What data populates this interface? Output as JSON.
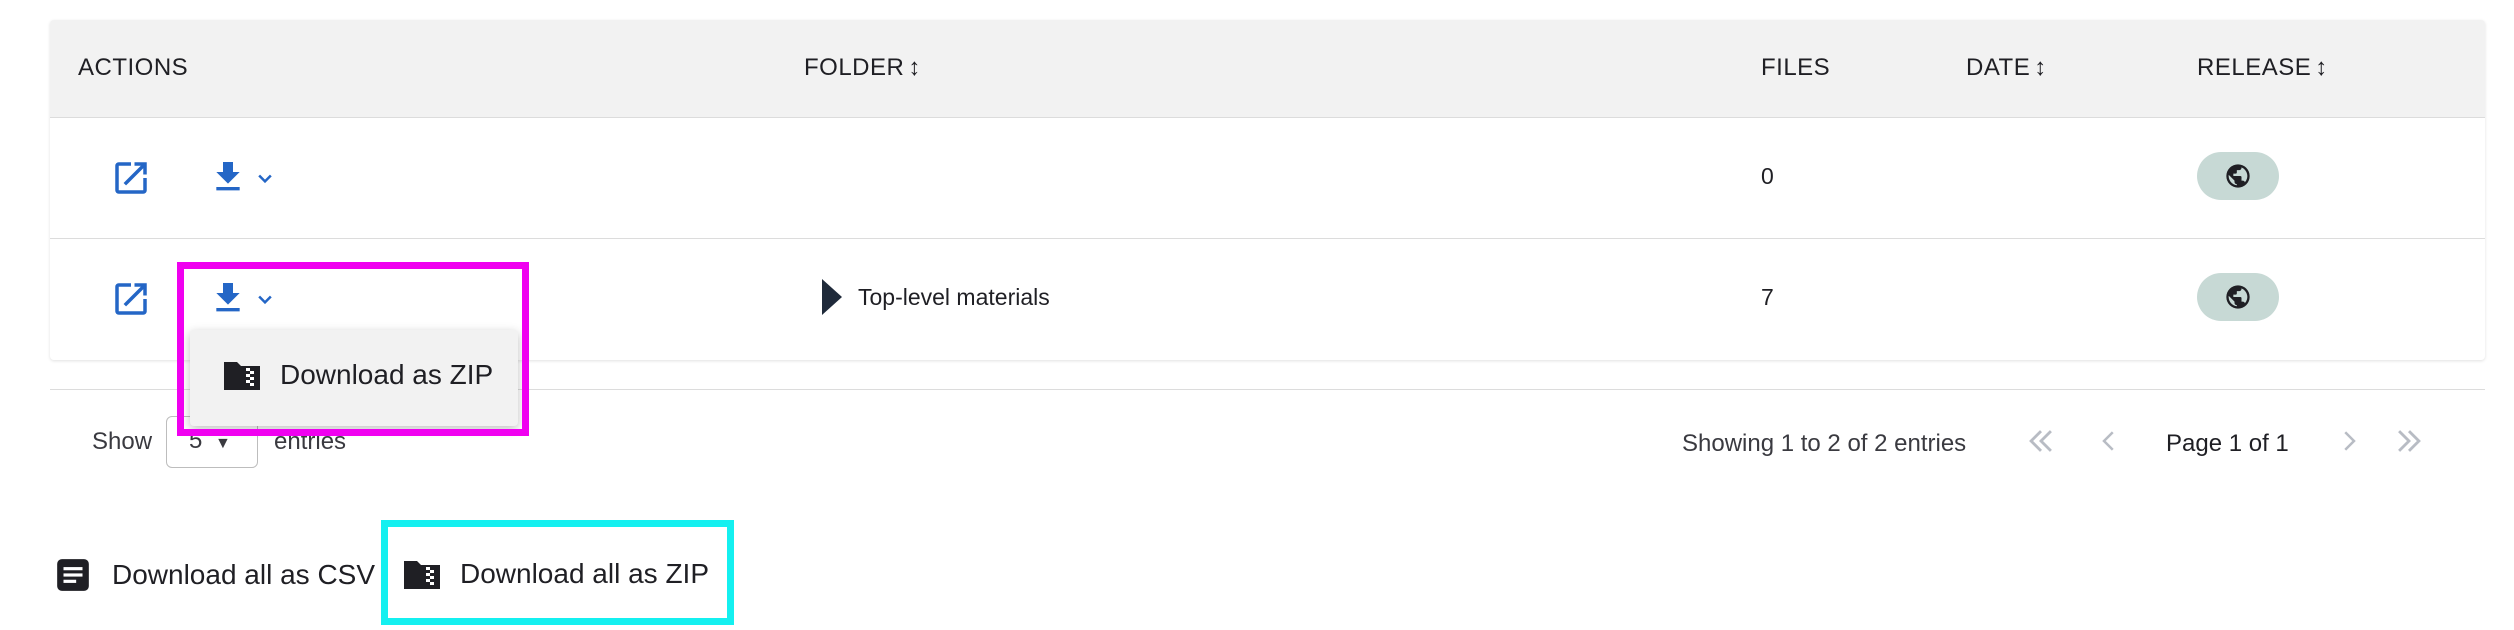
{
  "table": {
    "headers": {
      "actions": "ACTIONS",
      "folder": "FOLDER",
      "files": "FILES",
      "date": "DATE",
      "release": "RELEASE",
      "sort_glyph": "↕"
    },
    "rows": [
      {
        "folder": "",
        "files": "0",
        "date": ""
      },
      {
        "folder": "Top-level materials",
        "files": "7",
        "date": ""
      }
    ]
  },
  "download_menu": {
    "item_label": "Download as ZIP"
  },
  "footer": {
    "show_label": "Show",
    "entries_select_value": "5",
    "entries_label": "entries",
    "showing_text": "Showing 1 to 2 of 2 entries",
    "page_text": "Page 1 of 1"
  },
  "bottom_actions": {
    "csv_label": "Download all as CSV",
    "zip_label": "Download all as ZIP"
  },
  "colors": {
    "accent_blue": "#2466c6",
    "badge_bg": "#c7d9d5",
    "highlight_magenta": "#f000f0",
    "highlight_cyan": "#14f0f0"
  }
}
